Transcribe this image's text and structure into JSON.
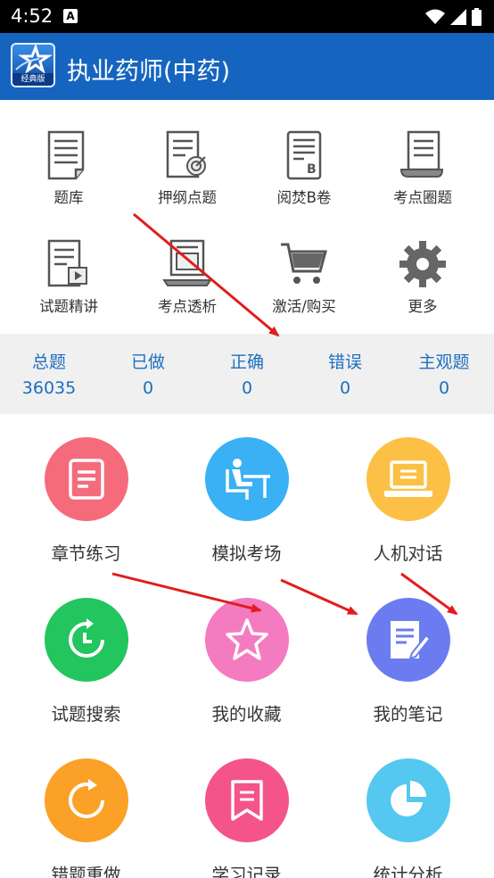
{
  "status_bar": {
    "time": "4:52",
    "notification_letter": "A"
  },
  "app_bar": {
    "title": "执业药师(中药)",
    "logo_badge": "经典版"
  },
  "top_grid": [
    {
      "label": "题库",
      "icon": "document-icon"
    },
    {
      "label": "押纲点题",
      "icon": "target-document-icon"
    },
    {
      "label": "阅焚B卷",
      "icon": "b-paper-icon"
    },
    {
      "label": "考点圈题",
      "icon": "scroll-icon"
    },
    {
      "label": "试题精讲",
      "icon": "video-document-icon"
    },
    {
      "label": "考点透析",
      "icon": "laptop-document-icon"
    },
    {
      "label": "激活/购买",
      "icon": "cart-icon"
    },
    {
      "label": "更多",
      "icon": "gear-icon"
    }
  ],
  "stats": [
    {
      "label": "总题",
      "value": "36035"
    },
    {
      "label": "已做",
      "value": "0"
    },
    {
      "label": "正确",
      "value": "0"
    },
    {
      "label": "错误",
      "value": "0"
    },
    {
      "label": "主观题",
      "value": "0"
    }
  ],
  "main_grid": [
    {
      "label": "章节练习",
      "icon": "list-note-icon",
      "color": "#f56b7c"
    },
    {
      "label": "模拟考场",
      "icon": "exam-desk-icon",
      "color": "#3ab0f5"
    },
    {
      "label": "人机对话",
      "icon": "laptop-icon",
      "color": "#fbc045"
    },
    {
      "label": "试题搜索",
      "icon": "clock-refresh-icon",
      "color": "#22c55e"
    },
    {
      "label": "我的收藏",
      "icon": "star-icon",
      "color": "#f47bc0"
    },
    {
      "label": "我的笔记",
      "icon": "note-edit-icon",
      "color": "#6b7cf0"
    },
    {
      "label": "错题重做",
      "icon": "refresh-icon",
      "color": "#fba127"
    },
    {
      "label": "学习记录",
      "icon": "bookmark-icon",
      "color": "#f4548a"
    },
    {
      "label": "统计分析",
      "icon": "pie-chart-icon",
      "color": "#54c8f0"
    }
  ]
}
